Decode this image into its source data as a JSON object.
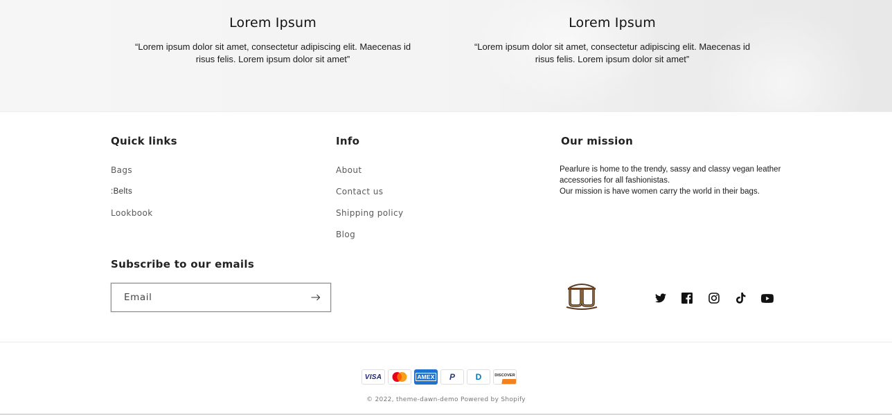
{
  "testimonials": [
    {
      "title": "Lorem Ipsum",
      "quote": "“Lorem ipsum dolor sit amet, consectetur adipiscing elit. Maecenas id risus felis. Lorem ipsum dolor sit amet”"
    },
    {
      "title": "Lorem Ipsum",
      "quote": "“Lorem ipsum dolor sit amet, consectetur adipiscing elit. Maecenas id risus felis. Lorem ipsum dolor sit amet”"
    }
  ],
  "footer": {
    "quick_links": {
      "heading": "Quick links",
      "items": [
        "Bags",
        ":Belts",
        "Lookbook"
      ]
    },
    "info": {
      "heading": "Info",
      "items": [
        "About",
        "Contact us",
        "Shipping policy",
        "Blog"
      ]
    },
    "mission": {
      "heading": "Our mission",
      "line1": "Pearlure is home to the trendy, sassy and classy vegan leather accessories for all fashionistas.",
      "line2": "Our mission is have women carry the world in their bags."
    },
    "newsletter": {
      "heading": "Subscribe to our emails",
      "placeholder": "Email",
      "submit_icon": "arrow-right-icon"
    },
    "social": [
      "twitter-icon",
      "facebook-icon",
      "instagram-icon",
      "tiktok-icon",
      "youtube-icon"
    ],
    "payments": {
      "visa": "VISA",
      "amex": "AMEX",
      "paypal": "P",
      "diners": "D",
      "discover": "DISCOVER"
    },
    "copyright": {
      "prefix": "© 2022,",
      "store": "theme-dawn-demo",
      "powered": "Powered by Shopify"
    }
  }
}
